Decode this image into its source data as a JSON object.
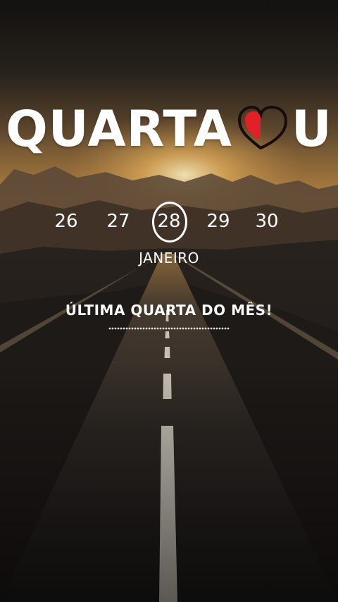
{
  "title": {
    "text": "QUARTA",
    "tail": "U"
  },
  "heart": {
    "outline_color": "#1a0b0b",
    "fill_color": "#e1202a"
  },
  "days": [
    "26",
    "27",
    "28",
    "29",
    "30"
  ],
  "selected_day": "28",
  "month": "JANEIRO",
  "subtitle": "ÚLTIMA QUARTA DO MÊS!"
}
